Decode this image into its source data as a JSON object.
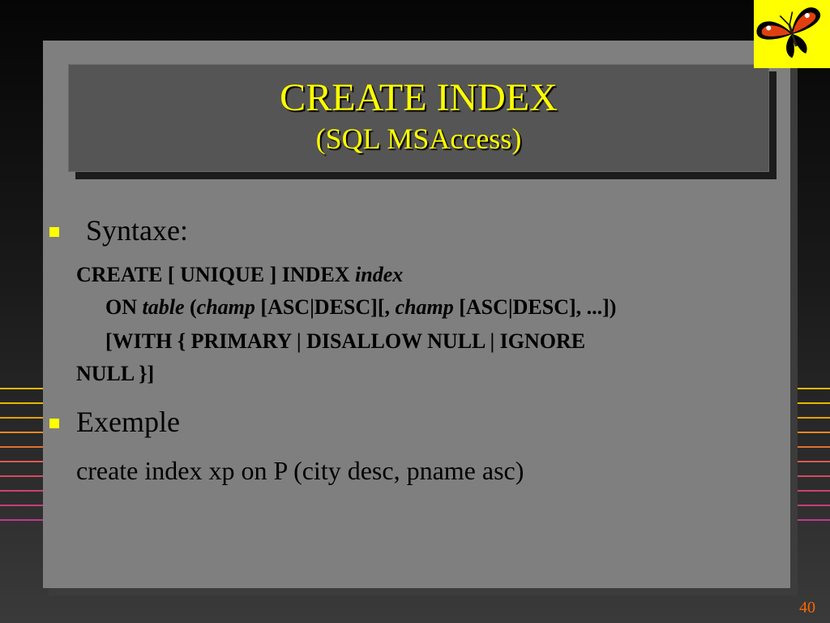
{
  "slide": {
    "title": "CREATE INDEX",
    "subtitle": "(SQL MSAccess)",
    "page_number": "40"
  },
  "content": {
    "bullet1": "Syntaxe:",
    "syntax": {
      "l1_kw": "CREATE [ UNIQUE ] INDEX ",
      "l1_it": "index",
      "l2_a": "ON ",
      "l2_b": "table",
      "l2_c": " (",
      "l2_d": "champ",
      "l2_e": " [ASC|DESC][, ",
      "l2_f": "champ",
      "l2_g": " [ASC|DESC], ...])",
      "l3": "[WITH { PRIMARY | DISALLOW NULL | IGNORE",
      "l4": "NULL }]"
    },
    "bullet2": "Exemple",
    "example": "create index xp on P (city desc, pname asc)"
  },
  "colors": {
    "title_text": "#ffff00",
    "bullet": "#ffff00",
    "panel": "#7f7f7f",
    "title_box": "#555555",
    "page_number": "#ff6600"
  },
  "icons": [
    "butterfly-logo-icon"
  ]
}
